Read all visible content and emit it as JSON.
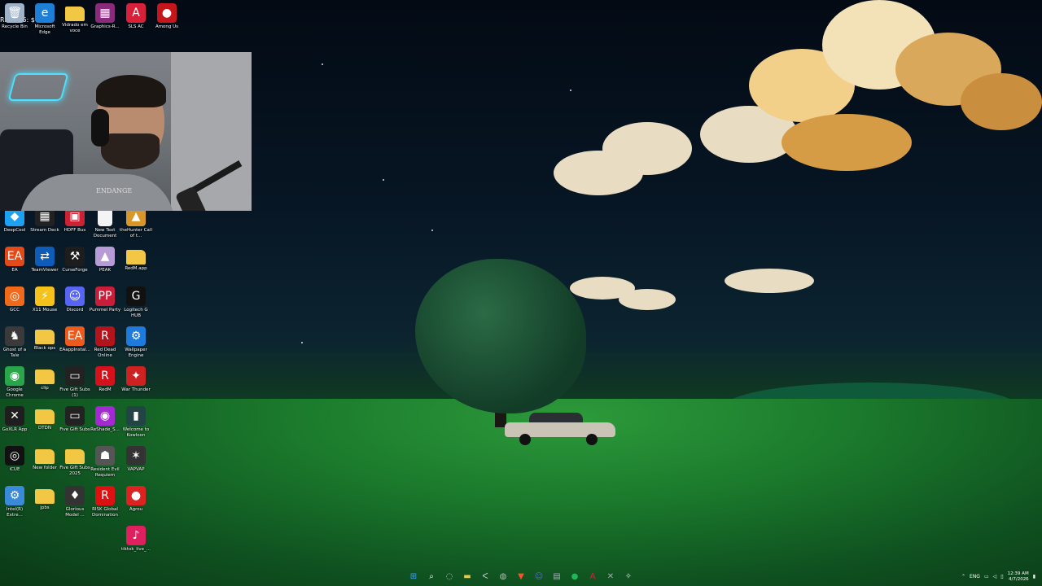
{
  "top_overlay_text": "RN: R86: $0.00",
  "desktop_icons": [
    {
      "label": "Recycle Bin",
      "icon": "recycle-bin-icon",
      "color": "#9fb3c8",
      "glyph": "🗑",
      "col": 0,
      "row": 0
    },
    {
      "label": "Microsoft Edge",
      "icon": "edge-icon",
      "color": "#1e7fd6",
      "glyph": "e",
      "col": 1,
      "row": 0
    },
    {
      "label": "Vidrado em voce",
      "icon": "folder-icon",
      "color": "#f2c744",
      "glyph": "",
      "col": 2,
      "row": 0
    },
    {
      "label": "Graphics-R...",
      "icon": "winrar-icon",
      "color": "#8a2a7a",
      "glyph": "▦",
      "col": 3,
      "row": 0
    },
    {
      "label": "SLS AC",
      "icon": "sls-icon",
      "color": "#d9203a",
      "glyph": "A",
      "col": 4,
      "row": 0
    },
    {
      "label": "Among Us",
      "icon": "among-us-icon",
      "color": "#c4161c",
      "glyph": "●",
      "col": 5,
      "row": 0
    },
    {
      "label": "DeepCool",
      "icon": "deepcool-icon",
      "color": "#1da1f2",
      "glyph": "◆",
      "col": 0,
      "row": 5
    },
    {
      "label": "Stream Deck",
      "icon": "stream-deck-icon",
      "color": "#222",
      "glyph": "▦",
      "col": 1,
      "row": 5
    },
    {
      "label": "HDFF Bus",
      "icon": "hdff-icon",
      "color": "#c23",
      "glyph": "▣",
      "col": 2,
      "row": 5
    },
    {
      "label": "New Text Document",
      "icon": "text-doc-icon",
      "color": "#f4f4f4",
      "glyph": "",
      "col": 3,
      "row": 5
    },
    {
      "label": "theHunter Call of t...",
      "icon": "thehunter-icon",
      "color": "#d9972a",
      "glyph": "▲",
      "col": 4,
      "row": 5
    },
    {
      "label": "EA",
      "icon": "ea-icon",
      "color": "#e24a1a",
      "glyph": "EA",
      "col": 0,
      "row": 6
    },
    {
      "label": "TeamViewer",
      "icon": "teamviewer-icon",
      "color": "#0e5bb8",
      "glyph": "⇄",
      "col": 1,
      "row": 6
    },
    {
      "label": "CurseForge",
      "icon": "curseforge-icon",
      "color": "#1d1d1d",
      "glyph": "⚒",
      "col": 2,
      "row": 6
    },
    {
      "label": "PEAK",
      "icon": "peak-icon",
      "color": "#b79bd6",
      "glyph": "▲",
      "col": 3,
      "row": 6
    },
    {
      "label": "RedM.app",
      "icon": "folder-icon",
      "color": "#f2c744",
      "glyph": "",
      "col": 4,
      "row": 6
    },
    {
      "label": "GCC",
      "icon": "gcc-icon",
      "color": "#f06a1c",
      "glyph": "◎",
      "col": 0,
      "row": 7
    },
    {
      "label": "X11 Mouse",
      "icon": "x11-mouse-icon",
      "color": "#f5c21c",
      "glyph": "⚡",
      "col": 1,
      "row": 7
    },
    {
      "label": "Discord",
      "icon": "discord-icon",
      "color": "#5865f2",
      "glyph": "☺",
      "col": 2,
      "row": 7
    },
    {
      "label": "Pummel Party",
      "icon": "pummel-party-icon",
      "color": "#c81e3a",
      "glyph": "PP",
      "col": 3,
      "row": 7
    },
    {
      "label": "Logitech G HUB",
      "icon": "logitech-icon",
      "color": "#111",
      "glyph": "G",
      "col": 4,
      "row": 7
    },
    {
      "label": "Ghost of a Tale",
      "icon": "ghost-of-a-tale-icon",
      "color": "#3a3a3a",
      "glyph": "♞",
      "col": 0,
      "row": 8
    },
    {
      "label": "Black ops",
      "icon": "folder-icon",
      "color": "#f2c744",
      "glyph": "",
      "col": 1,
      "row": 8
    },
    {
      "label": "EAappInstal...",
      "icon": "ea-app-icon",
      "color": "#ee5a1c",
      "glyph": "EA",
      "col": 2,
      "row": 8
    },
    {
      "label": "Red Dead Online",
      "icon": "rdo-icon",
      "color": "#b3141b",
      "glyph": "R",
      "col": 3,
      "row": 8
    },
    {
      "label": "Wallpaper Engine",
      "icon": "wallpaper-engine-icon",
      "color": "#1e7bdb",
      "glyph": "⚙",
      "col": 4,
      "row": 8
    },
    {
      "label": "Google Chrome",
      "icon": "chrome-icon",
      "color": "#2aa54a",
      "glyph": "◉",
      "col": 0,
      "row": 9
    },
    {
      "label": "clip",
      "icon": "folder-icon",
      "color": "#f2c744",
      "glyph": "",
      "col": 1,
      "row": 9
    },
    {
      "label": "Five Gift Subs (1)",
      "icon": "video-icon",
      "color": "#222",
      "glyph": "▭",
      "col": 2,
      "row": 9
    },
    {
      "label": "RedM",
      "icon": "redm-icon",
      "color": "#d3121b",
      "glyph": "R",
      "col": 3,
      "row": 9
    },
    {
      "label": "War Thunder",
      "icon": "war-thunder-icon",
      "color": "#c22",
      "glyph": "✦",
      "col": 4,
      "row": 9
    },
    {
      "label": "GoXLR App",
      "icon": "goxlr-icon",
      "color": "#1e1e1e",
      "glyph": "✕",
      "col": 0,
      "row": 10
    },
    {
      "label": "DTDN",
      "icon": "folder-icon",
      "color": "#f2c744",
      "glyph": "",
      "col": 1,
      "row": 10
    },
    {
      "label": "Five Gift Subs",
      "icon": "video-icon",
      "color": "#222",
      "glyph": "▭",
      "col": 2,
      "row": 10
    },
    {
      "label": "ReShade_S...",
      "icon": "reshade-icon",
      "color": "#a22ad0",
      "glyph": "◉",
      "col": 3,
      "row": 10
    },
    {
      "label": "Welcome to Kowloon",
      "icon": "kowloon-icon",
      "color": "#244",
      "glyph": "▮",
      "col": 4,
      "row": 10
    },
    {
      "label": "iCUE",
      "icon": "icue-icon",
      "color": "#111",
      "glyph": "◎",
      "col": 0,
      "row": 11
    },
    {
      "label": "New folder",
      "icon": "folder-icon",
      "color": "#f2c744",
      "glyph": "",
      "col": 1,
      "row": 11
    },
    {
      "label": "Five Gift Subs 2025",
      "icon": "folder-icon",
      "color": "#f2c744",
      "glyph": "",
      "col": 2,
      "row": 11
    },
    {
      "label": "Resident Evil Requiem",
      "icon": "resident-evil-icon",
      "color": "#555",
      "glyph": "☗",
      "col": 3,
      "row": 11
    },
    {
      "label": "VAPVAP",
      "icon": "vapvap-icon",
      "color": "#333",
      "glyph": "✶",
      "col": 4,
      "row": 11
    },
    {
      "label": "Intel(R) Extre...",
      "icon": "intel-icon",
      "color": "#3b8ad9",
      "glyph": "⚙",
      "col": 0,
      "row": 12
    },
    {
      "label": "jpbs",
      "icon": "folder-icon",
      "color": "#f2c744",
      "glyph": "",
      "col": 1,
      "row": 12
    },
    {
      "label": "Glorious Model ...",
      "icon": "glorious-icon",
      "color": "#333",
      "glyph": "♦",
      "col": 2,
      "row": 12
    },
    {
      "label": "RISK Global Domination",
      "icon": "risk-icon",
      "color": "#d11",
      "glyph": "R",
      "col": 3,
      "row": 12
    },
    {
      "label": "Agrou",
      "icon": "agrou-icon",
      "color": "#d22",
      "glyph": "●",
      "col": 4,
      "row": 12
    },
    {
      "label": "tiktok_live_...",
      "icon": "tiktok-icon",
      "color": "#e01f5e",
      "glyph": "♪",
      "col": 4,
      "row": 13
    }
  ],
  "webcam": {
    "shirt_text": "ENDANGE"
  },
  "taskbar": {
    "items": [
      {
        "name": "start-button",
        "glyph": "⊞",
        "color": "#3aa0ff"
      },
      {
        "name": "search-button",
        "glyph": "⌕",
        "color": "#fff"
      },
      {
        "name": "taskbar-app-1",
        "glyph": "◌",
        "color": "#ccc"
      },
      {
        "name": "file-explorer-taskbar",
        "glyph": "▬",
        "color": "#f2c744"
      },
      {
        "name": "taskbar-app-2",
        "glyph": "ᐸ",
        "color": "#ddd"
      },
      {
        "name": "taskbar-app-3",
        "glyph": "◍",
        "color": "#bbb"
      },
      {
        "name": "brave-taskbar",
        "glyph": "▼",
        "color": "#fb542b"
      },
      {
        "name": "discord-taskbar",
        "glyph": "☺",
        "color": "#5865f2"
      },
      {
        "name": "taskbar-app-4",
        "glyph": "▤",
        "color": "#aab"
      },
      {
        "name": "spotify-taskbar",
        "glyph": "●",
        "color": "#1db954"
      },
      {
        "name": "taskbar-app-5",
        "glyph": "A",
        "color": "#e01b3c"
      },
      {
        "name": "taskbar-app-6",
        "glyph": "✕",
        "color": "#aaa"
      },
      {
        "name": "taskbar-app-7",
        "glyph": "✧",
        "color": "#ddd"
      }
    ],
    "tray": {
      "chevron": "⌃",
      "lang": "ENG",
      "time": "12:39 AM",
      "date": "4/7/2026"
    }
  }
}
